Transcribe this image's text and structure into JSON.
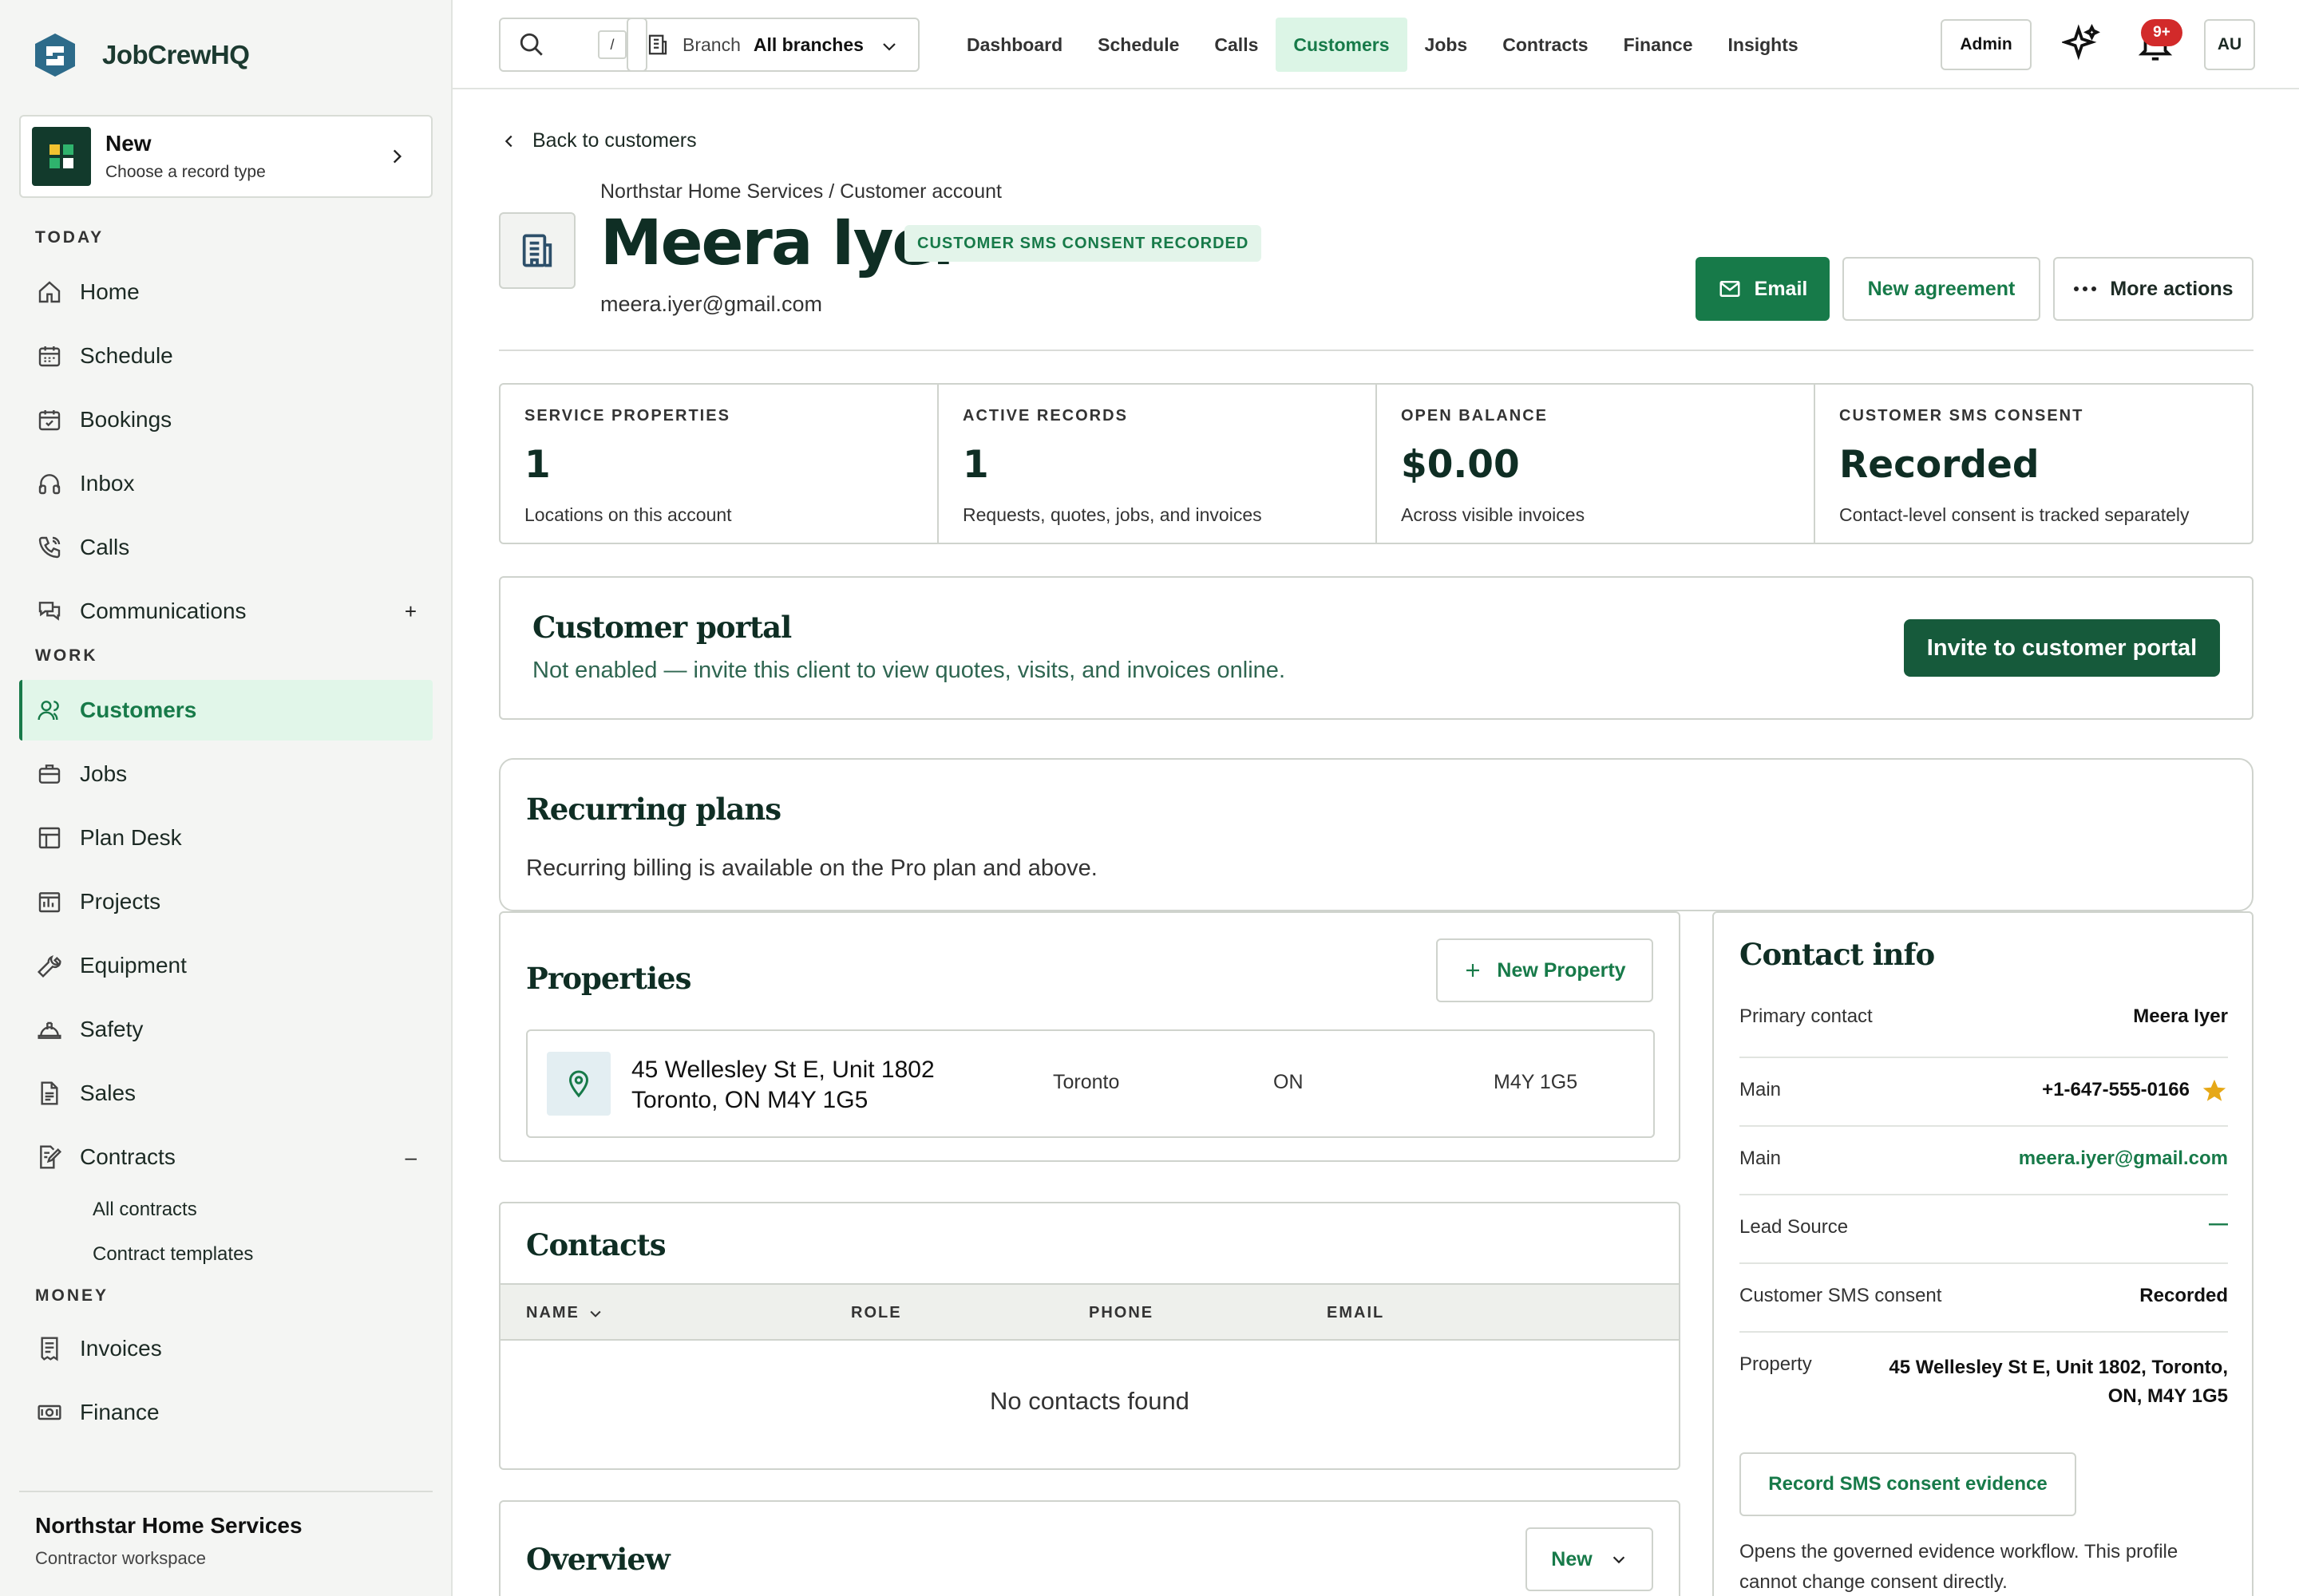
{
  "app": {
    "name": "JobCrewHQ"
  },
  "colors": {
    "accent": "#177a49",
    "accent_dark": "#165a3b",
    "active_bg": "#e1f6e9",
    "badge": "#d22a2a",
    "star": "#e6a817"
  },
  "sidebar": {
    "new_card": {
      "title": "New",
      "subtitle": "Choose a record type"
    },
    "sections": {
      "today": "TODAY",
      "work": "WORK",
      "money": "MONEY"
    },
    "today_items": [
      {
        "label": "Home",
        "icon": "home-icon"
      },
      {
        "label": "Schedule",
        "icon": "calendar-icon"
      },
      {
        "label": "Bookings",
        "icon": "calendar-check-icon"
      },
      {
        "label": "Inbox",
        "icon": "headphones-icon"
      },
      {
        "label": "Calls",
        "icon": "phone-icon"
      },
      {
        "label": "Communications",
        "icon": "chat-icon",
        "sign": "+"
      }
    ],
    "work_items": [
      {
        "label": "Customers",
        "icon": "users-icon",
        "active": true
      },
      {
        "label": "Jobs",
        "icon": "briefcase-icon"
      },
      {
        "label": "Plan Desk",
        "icon": "layout-icon"
      },
      {
        "label": "Projects",
        "icon": "projects-icon"
      },
      {
        "label": "Equipment",
        "icon": "wrench-icon"
      },
      {
        "label": "Safety",
        "icon": "hardhat-icon"
      },
      {
        "label": "Sales",
        "icon": "document-icon"
      },
      {
        "label": "Contracts",
        "icon": "contract-icon",
        "sign": "–"
      }
    ],
    "contracts_sub": [
      "All contracts",
      "Contract templates"
    ],
    "money_items": [
      {
        "label": "Invoices",
        "icon": "invoice-icon"
      },
      {
        "label": "Finance",
        "icon": "cash-icon"
      }
    ],
    "workspace": {
      "name": "Northstar Home Services",
      "type": "Contractor workspace"
    }
  },
  "topbar": {
    "search_shortcut": "/",
    "branch_label": "Branch",
    "branch_value": "All branches",
    "nav": [
      "Dashboard",
      "Schedule",
      "Calls",
      "Customers",
      "Jobs",
      "Contracts",
      "Finance",
      "Insights"
    ],
    "active_nav": "Customers",
    "admin": "Admin",
    "notifications_badge": "9+",
    "avatar": "AU"
  },
  "header": {
    "back": "Back to customers",
    "breadcrumb": "Northstar Home Services / Customer account",
    "name": "Meera Iyer",
    "consent_badge": "CUSTOMER SMS CONSENT RECORDED",
    "email": "meera.iyer@gmail.com",
    "actions": {
      "email": "Email",
      "new_agreement": "New agreement",
      "more": "More actions"
    }
  },
  "stats": [
    {
      "key": "SERVICE PROPERTIES",
      "value": "1",
      "desc": "Locations on this account"
    },
    {
      "key": "ACTIVE RECORDS",
      "value": "1",
      "desc": "Requests, quotes, jobs, and invoices"
    },
    {
      "key": "OPEN BALANCE",
      "value": "$0.00",
      "desc": "Across visible invoices"
    },
    {
      "key": "CUSTOMER SMS CONSENT",
      "value": "Recorded",
      "desc": "Contact-level consent is tracked separately"
    }
  ],
  "portal": {
    "title": "Customer portal",
    "desc": "Not enabled — invite this client to view quotes, visits, and invoices online.",
    "button": "Invite to customer portal"
  },
  "recurring": {
    "title": "Recurring plans",
    "desc": "Recurring billing is available on the Pro plan and above."
  },
  "properties": {
    "title": "Properties",
    "new_button": "New Property",
    "rows": [
      {
        "line1": "45 Wellesley St E, Unit 1802",
        "line2": "Toronto, ON M4Y 1G5",
        "city": "Toronto",
        "province": "ON",
        "postal": "M4Y 1G5"
      }
    ]
  },
  "contacts": {
    "title": "Contacts",
    "columns": [
      "NAME",
      "ROLE",
      "PHONE",
      "EMAIL"
    ],
    "empty": "No contacts found"
  },
  "overview": {
    "title": "Overview",
    "button": "New"
  },
  "contact_info": {
    "title": "Contact info",
    "rows": [
      {
        "key": "Primary contact",
        "value": "Meera Iyer"
      },
      {
        "key": "Main",
        "value": "+1-647-555-0166"
      },
      {
        "key": "Main",
        "value": "meera.iyer@gmail.com"
      },
      {
        "key": "Lead Source",
        "value": "—"
      },
      {
        "key": "Customer SMS consent",
        "value": "Recorded"
      },
      {
        "key": "Property",
        "value": "45 Wellesley St E, Unit 1802, Toronto, ON, M4Y 1G5"
      }
    ],
    "record_button": "Record SMS consent evidence",
    "note": "Opens the governed evidence workflow. This profile cannot change consent directly."
  }
}
